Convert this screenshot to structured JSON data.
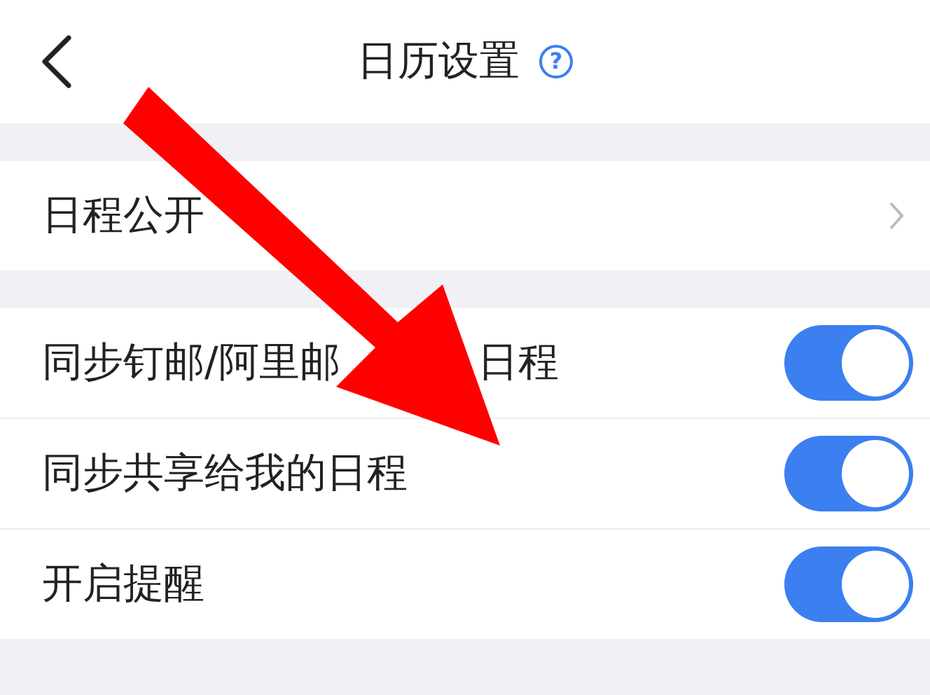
{
  "header": {
    "title": "日历设置",
    "help": "?"
  },
  "sections": [
    {
      "rows": [
        {
          "kind": "link",
          "label": [
            "日程公开"
          ]
        }
      ]
    },
    {
      "rows": [
        {
          "kind": "toggle",
          "label": [
            "同步钉邮/阿里邮",
            "日程"
          ],
          "on": true
        },
        {
          "kind": "toggle",
          "label": "同步共享给我的日程",
          "on": true
        },
        {
          "kind": "toggle",
          "label": "开启提醒",
          "on": true
        }
      ]
    }
  ],
  "annotation": {
    "kind": "arrow"
  }
}
